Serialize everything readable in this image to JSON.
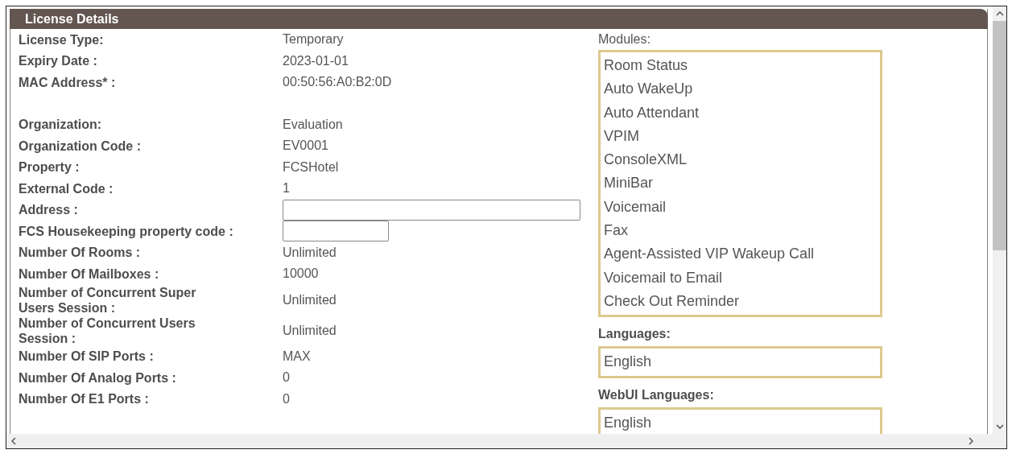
{
  "panel": {
    "title": "License Details"
  },
  "field_groups": [
    [
      {
        "label": "License Type:",
        "kind": "value",
        "value": "Temporary"
      },
      {
        "label": "**Expiry Date** :",
        "kind": "value",
        "value": "2023-01-01"
      },
      {
        "label": "**MAC Address*** :",
        "kind": "value",
        "value": "00:50:56:A0:B2:0D"
      }
    ],
    [
      {
        "label": "Organization:",
        "kind": "value",
        "value": "Evaluation"
      },
      {
        "label": "Organization Code :",
        "kind": "value",
        "value": "EV0001"
      },
      {
        "label": "**Property** :",
        "kind": "value",
        "value": "FCSHotel"
      },
      {
        "label": "**External Code** :",
        "kind": "value",
        "value": "1"
      },
      {
        "label": "**Address** :",
        "kind": "wide-input"
      },
      {
        "label": "**FCS Housekeeping property code** :",
        "kind": "short-input"
      },
      {
        "label": "**Number Of Rooms** :",
        "kind": "value",
        "value": "Unlimited"
      },
      {
        "label": "**Number Of Mailboxes** :",
        "kind": "value",
        "value": "10000"
      },
      {
        "label": "Number of Concurrent Super Users Session  :",
        "kind": "value",
        "value": "Unlimited"
      },
      {
        "label": "Number of Concurrent Users Session  :",
        "kind": "value",
        "value": "Unlimited"
      },
      {
        "label": "**Number Of SIP Ports** :",
        "kind": "value",
        "value": "MAX"
      },
      {
        "label": "**Number Of Analog Ports** :",
        "kind": "value",
        "value": "0"
      },
      {
        "label": "**Number Of E1 Ports** :",
        "kind": "value",
        "value": "0"
      }
    ]
  ],
  "modules": {
    "label": "Modules:",
    "items": [
      "Room Status",
      "Auto WakeUp",
      "Auto Attendant",
      "VPIM",
      "ConsoleXML",
      "MiniBar",
      "Voicemail",
      "Fax",
      "Agent-Assisted VIP Wakeup Call",
      "Voicemail to Email",
      "Check Out Reminder"
    ]
  },
  "languages": {
    "label": "Languages:",
    "items": [
      "English"
    ]
  },
  "webui_languages": {
    "label": "WebUI Languages:",
    "items": [
      "English"
    ]
  }
}
